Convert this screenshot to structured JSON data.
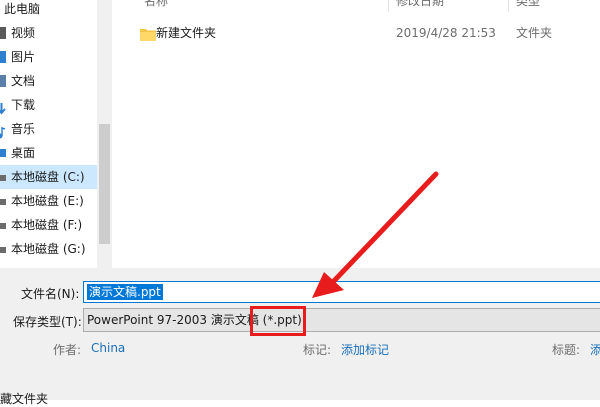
{
  "nav": {
    "items": [
      {
        "label": "此电脑",
        "icon": "computer-icon",
        "selected": false
      },
      {
        "label": "视频",
        "icon": "video-icon",
        "selected": false
      },
      {
        "label": "图片",
        "icon": "picture-icon",
        "selected": false
      },
      {
        "label": "文档",
        "icon": "document-icon",
        "selected": false
      },
      {
        "label": "下载",
        "icon": "download-icon",
        "selected": false
      },
      {
        "label": "音乐",
        "icon": "music-icon",
        "selected": false
      },
      {
        "label": "桌面",
        "icon": "desktop-icon",
        "selected": false
      },
      {
        "label": "本地磁盘 (C:)",
        "icon": "drive-icon",
        "selected": true
      },
      {
        "label": "本地磁盘 (E:)",
        "icon": "drive-icon",
        "selected": false
      },
      {
        "label": "本地磁盘 (F:)",
        "icon": "drive-icon",
        "selected": false
      },
      {
        "label": "本地磁盘 (G:)",
        "icon": "drive-icon",
        "selected": false
      }
    ]
  },
  "list": {
    "headers": {
      "name": "名称",
      "date": "修改日期",
      "type": "类型"
    },
    "rows": [
      {
        "name": "新建文件夹",
        "date": "2019/4/28 21:53",
        "type": "文件夹",
        "icon": "folder-icon"
      }
    ]
  },
  "form": {
    "filename_label": "文件名(N):",
    "filename_value": "演示文稿.ppt",
    "savetype_label": "保存类型(T):",
    "savetype_value": "PowerPoint 97-2003 演示文稿 (*.ppt)",
    "author_label": "作者:",
    "author_value": "China",
    "tags_label": "标记:",
    "tags_value": "添加标记",
    "title_label": "标题:",
    "title_value": "添",
    "hide_folders_label": "藏文件夹"
  },
  "colors": {
    "accent": "#0078d7",
    "selection": "#cce8ff",
    "annotation": "#e81c1c",
    "link": "#1a6fb8"
  }
}
